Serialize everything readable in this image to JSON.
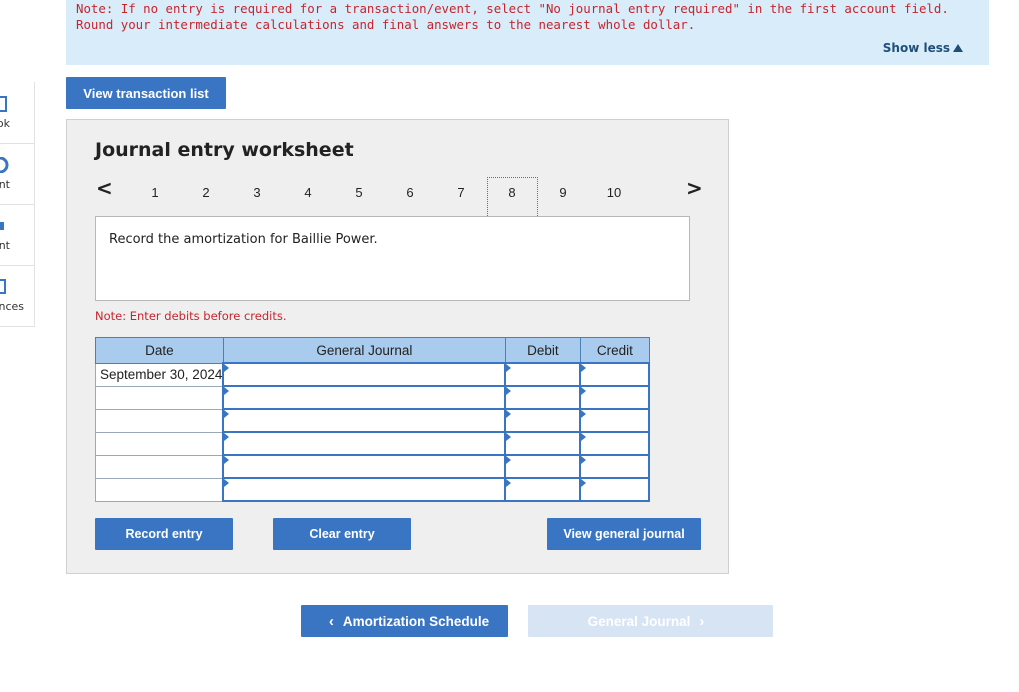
{
  "sidebar": {
    "items": [
      {
        "label": "ok",
        "icon": "book-icon"
      },
      {
        "label": "nt",
        "icon": "circle-arrow-icon"
      },
      {
        "label": "nt",
        "icon": "print-icon"
      },
      {
        "label": "nces",
        "icon": "document-icon"
      }
    ]
  },
  "banner": {
    "note": "Note: If no entry is required for a transaction/event, select \"No journal entry required\" in the first account field. Round your intermediate calculations and final answers to the nearest whole dollar.",
    "show_less": "Show less"
  },
  "toolbar": {
    "view_transaction_list": "View transaction list"
  },
  "worksheet": {
    "title": "Journal entry worksheet",
    "pages": [
      "1",
      "2",
      "3",
      "4",
      "5",
      "6",
      "7",
      "8",
      "9",
      "10"
    ],
    "active_page": "8",
    "prev_arrow": "<",
    "next_arrow": ">",
    "description": "Record the amortization for Baillie Power.",
    "note": "Note: Enter debits before credits.",
    "columns": {
      "date": "Date",
      "journal": "General Journal",
      "debit": "Debit",
      "credit": "Credit"
    },
    "rows": [
      {
        "date": "September 30, 2024",
        "journal": "",
        "debit": "",
        "credit": ""
      },
      {
        "date": "",
        "journal": "",
        "debit": "",
        "credit": ""
      },
      {
        "date": "",
        "journal": "",
        "debit": "",
        "credit": ""
      },
      {
        "date": "",
        "journal": "",
        "debit": "",
        "credit": ""
      },
      {
        "date": "",
        "journal": "",
        "debit": "",
        "credit": ""
      },
      {
        "date": "",
        "journal": "",
        "debit": "",
        "credit": ""
      }
    ],
    "record_entry": "Record entry",
    "clear_entry": "Clear entry",
    "view_general_journal": "View general journal"
  },
  "navigation": {
    "prev_label": "Amortization Schedule",
    "next_label": "General Journal"
  },
  "colors": {
    "primary_button": "#3a75c4",
    "disabled_button": "#d7e4f4",
    "note_red": "#c4262e",
    "banner_bg": "#d9ecf9",
    "header_bg": "#a9cbed"
  }
}
